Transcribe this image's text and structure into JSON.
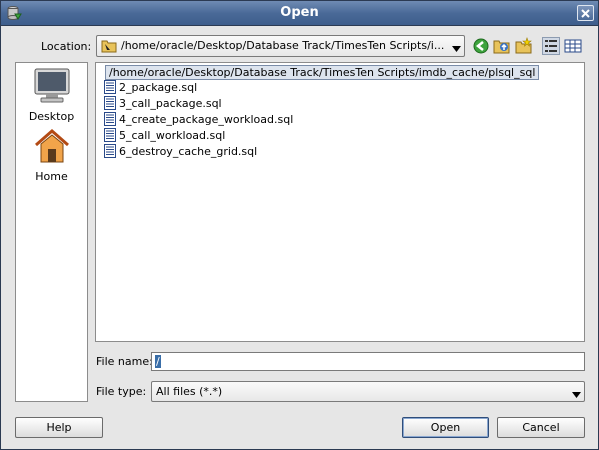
{
  "window": {
    "title": "Open"
  },
  "location": {
    "label": "Location:",
    "value": "/home/oracle/Desktop/Database Track/TimesTen Scripts/i...",
    "popup_path": "/home/oracle/Desktop/Database Track/TimesTen Scripts/imdb_cache/plsql_sql"
  },
  "toolbar_icons": [
    "back-icon",
    "up-folder-icon",
    "new-folder-icon",
    "list-view-icon",
    "details-view-icon"
  ],
  "places": [
    {
      "label": "Desktop",
      "icon": "desktop-icon"
    },
    {
      "label": "Home",
      "icon": "home-icon"
    }
  ],
  "files": [
    "2_package.sql",
    "3_call_package.sql",
    "4_create_package_workload.sql",
    "5_call_workload.sql",
    "6_destroy_cache_grid.sql"
  ],
  "file_name": {
    "label": "File name:",
    "value": "/"
  },
  "file_type": {
    "label": "File type:",
    "value": "All files (*.*)"
  },
  "buttons": {
    "help": "Help",
    "open": "Open",
    "cancel": "Cancel"
  },
  "colors": {
    "titlebar": "#4a6a98",
    "selection": "#3a6ea8",
    "dialog_bg": "#e6e6e6"
  }
}
